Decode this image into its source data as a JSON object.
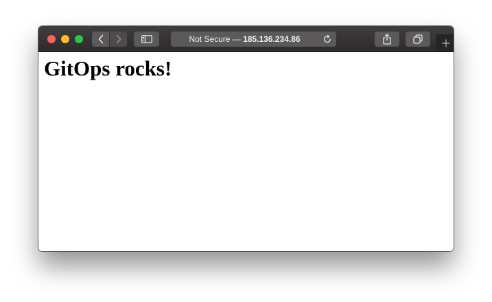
{
  "browser": {
    "address_bar": {
      "security_label": "Not Secure",
      "separator": " — ",
      "host": "185.136.234.86"
    },
    "icons": {
      "back": "chevron-left-icon",
      "forward": "chevron-right-icon",
      "sidebar": "sidebar-icon",
      "reload": "reload-icon",
      "share": "share-icon",
      "tabs": "tabs-icon",
      "new_tab": "plus-icon"
    },
    "colors": {
      "close": "#fe5f57",
      "minimize": "#febc2e",
      "maximize": "#28c840",
      "toolbar": "#3a3839"
    }
  },
  "page": {
    "heading": "GitOps rocks!"
  }
}
